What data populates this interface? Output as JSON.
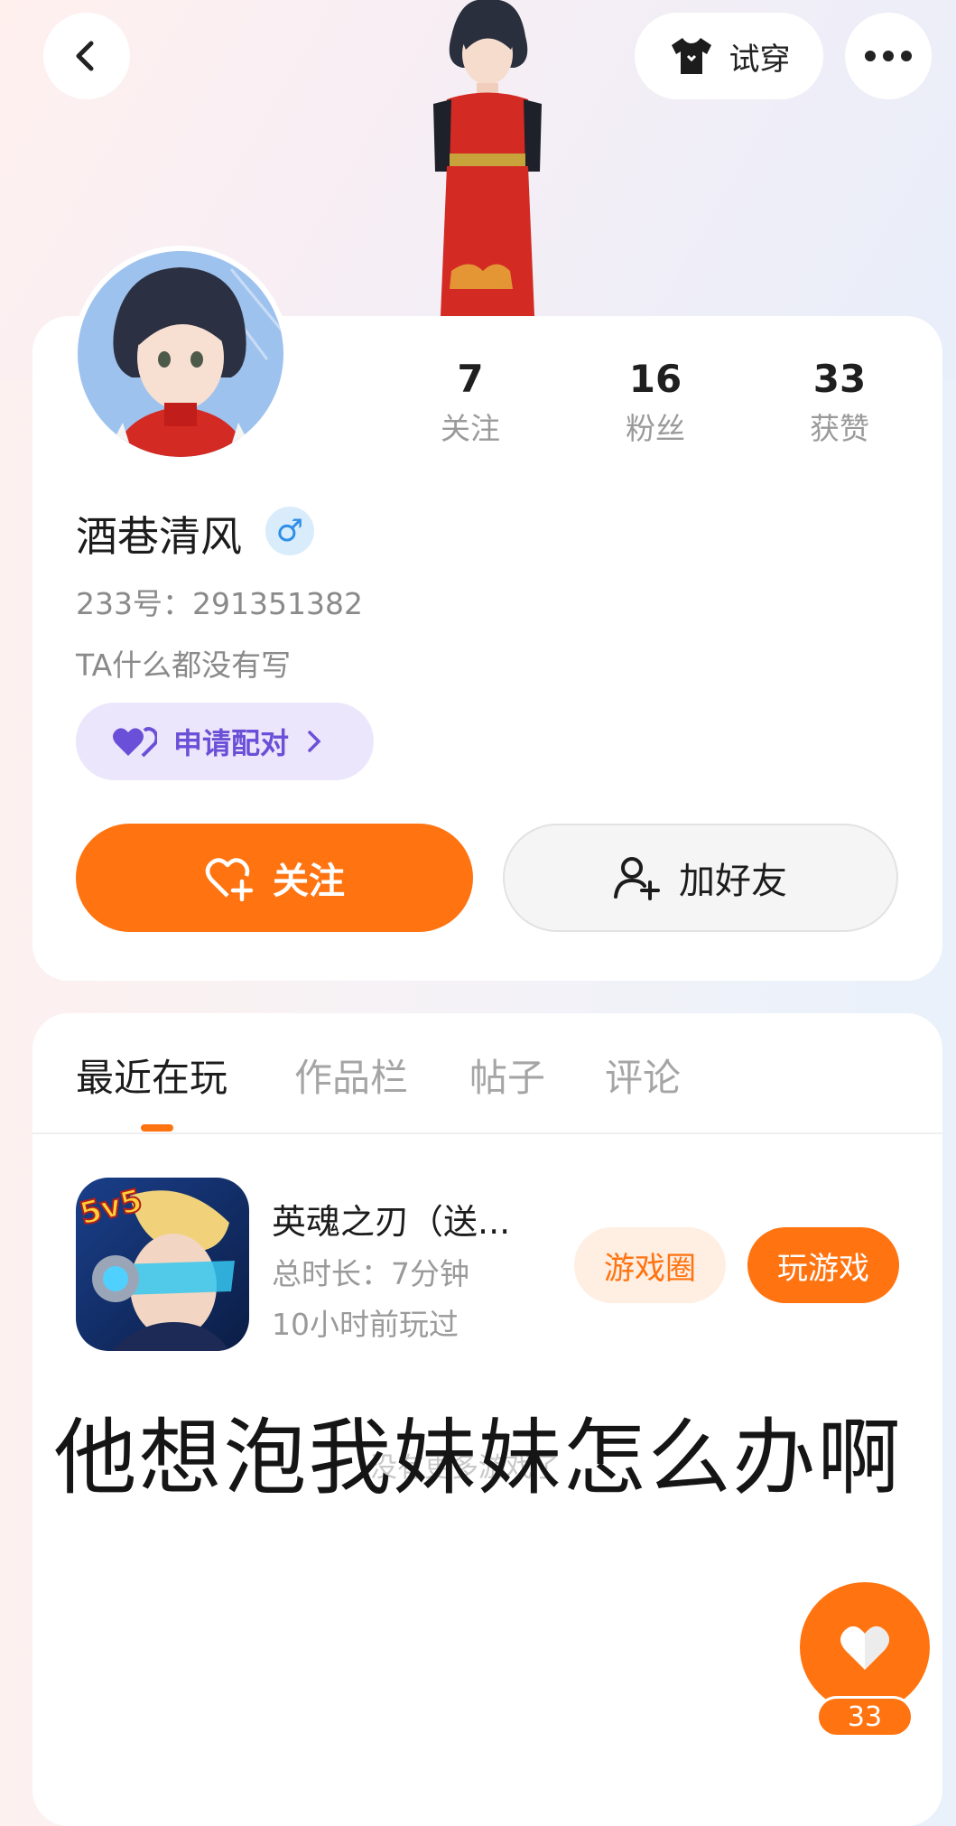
{
  "header": {
    "back_icon": "chevron-left-icon",
    "tryon_label": "试穿",
    "tryon_icon": "tshirt-icon",
    "more_icon": "more-dots-icon"
  },
  "profile": {
    "stats": [
      {
        "value": "7",
        "label": "关注"
      },
      {
        "value": "16",
        "label": "粉丝"
      },
      {
        "value": "33",
        "label": "获赞"
      }
    ],
    "name": "酒巷清风",
    "gender_symbol": "♂",
    "uid": "233号：291351382",
    "bio": "TA什么都没有写",
    "match_label": "申请配对",
    "follow_label": "关注",
    "add_friend_label": "加好友"
  },
  "tabs": [
    {
      "label": "最近在玩",
      "active": true
    },
    {
      "label": "作品栏",
      "active": false
    },
    {
      "label": "帖子",
      "active": false
    },
    {
      "label": "评论",
      "active": false
    }
  ],
  "game": {
    "icon_badge": "5v5",
    "title": "英魂之刃（送...",
    "duration": "总时长：7分钟",
    "last_played": "10小时前玩过",
    "circle_label": "游戏圈",
    "play_label": "玩游戏"
  },
  "overlay_text": "他想泡我妹妹怎么办啊",
  "watermark": "没有更多游戏了",
  "like": {
    "icon": "heart-icon",
    "count": "33"
  },
  "colors": {
    "accent": "#ff7310",
    "match_purple": "#6a50d8",
    "gender_blue": "#2f8ee8"
  }
}
